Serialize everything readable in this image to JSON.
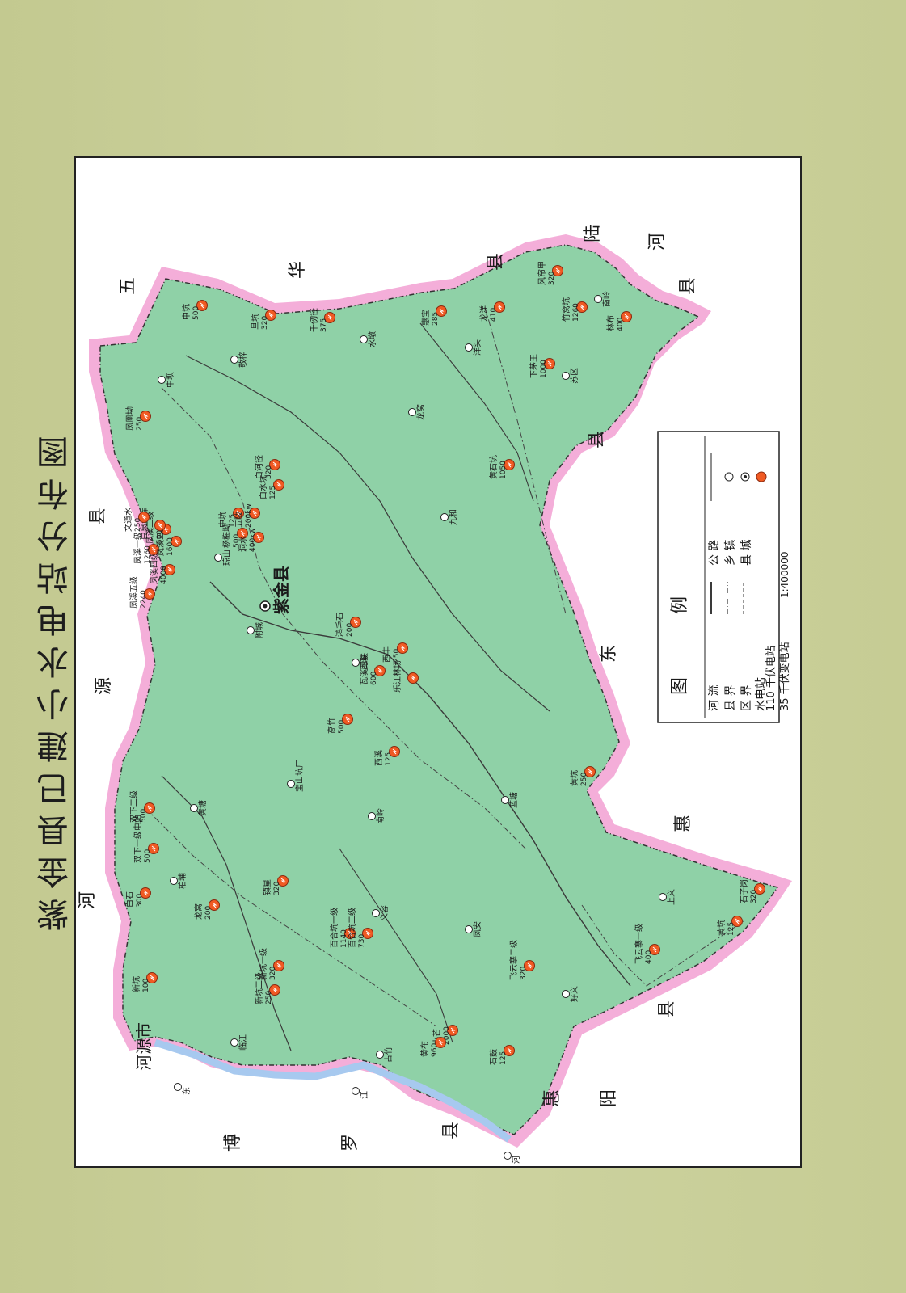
{
  "title": "紫金县已建小水电站分布图",
  "county_seat": "紫金县",
  "neighbors": [
    {
      "text": "河"
    },
    {
      "text": "源"
    },
    {
      "text": "县"
    },
    {
      "text": "五"
    },
    {
      "text": "华"
    },
    {
      "text": "县"
    },
    {
      "text": "陆"
    },
    {
      "text": "河"
    },
    {
      "text": "县"
    },
    {
      "text": "东"
    },
    {
      "text": "县"
    },
    {
      "text": "惠"
    },
    {
      "text": "县"
    },
    {
      "text": "阳"
    },
    {
      "text": "惠"
    },
    {
      "text": "县"
    },
    {
      "text": "罗"
    },
    {
      "text": "博"
    },
    {
      "text": "河源市"
    }
  ],
  "stations": [
    {
      "name": "新坑",
      "cap": "100"
    },
    {
      "name": "白石",
      "cap": "300"
    },
    {
      "name": "龙窝",
      "cap": "200"
    },
    {
      "name": "双下一级电站",
      "cap": "500"
    },
    {
      "name": "双下二级",
      "cap": "500"
    },
    {
      "name": "新坑二级",
      "cap": "250"
    },
    {
      "name": "新坑一级",
      "cap": "320"
    },
    {
      "name": "镇星",
      "cap": "320"
    },
    {
      "name": "百合坑一级",
      "cap": "1140"
    },
    {
      "name": "百合坑二级",
      "cap": "730"
    },
    {
      "name": "西溪",
      "cap": "125"
    },
    {
      "name": "高竹",
      "cap": "500"
    },
    {
      "name": "瓦溪四联",
      "cap": "600"
    },
    {
      "name": "鸿毛石",
      "cap": "200"
    },
    {
      "name": "凤溪四级",
      "cap": "4000"
    },
    {
      "name": "凤溪五级",
      "cap": "2240"
    },
    {
      "name": "凤溪一级",
      "cap": "1260"
    },
    {
      "name": "凤溪二级",
      "cap": "500"
    },
    {
      "name": "凤溪三级",
      "cap": "1600"
    },
    {
      "name": "白泉水库",
      "cap": ""
    },
    {
      "name": "文道水",
      "cap": "250"
    },
    {
      "name": "凤凰坳",
      "cap": "250"
    },
    {
      "name": "中坑",
      "cap": "125"
    },
    {
      "name": "白水坑",
      "cap": "125"
    },
    {
      "name": "白河径",
      "cap": "320"
    },
    {
      "name": "杨梅坳",
      "cap": "500"
    },
    {
      "name": "洞水",
      "cap": "400kw"
    },
    {
      "name": "五陂",
      "cap": "200kw"
    },
    {
      "name": "中坑",
      "cap": "500"
    },
    {
      "name": "旦坑",
      "cap": "320"
    },
    {
      "name": "千仞径",
      "cap": "375"
    },
    {
      "name": "惠宝",
      "cap": "285"
    },
    {
      "name": "龙洋",
      "cap": "410"
    },
    {
      "name": "下茅王",
      "cap": "1000"
    },
    {
      "name": "风帘甲",
      "cap": "320"
    },
    {
      "name": "竹窝坑",
      "cap": "1260"
    },
    {
      "name": "林布",
      "cap": "400"
    },
    {
      "name": "黄石坑",
      "cap": "1050"
    },
    {
      "name": "黄坑",
      "cap": "250"
    },
    {
      "name": "石子岗",
      "cap": "320"
    },
    {
      "name": "黄坑",
      "cap": "125"
    },
    {
      "name": "飞云寨一级",
      "cap": "400"
    },
    {
      "name": "飞云寨二级",
      "cap": "320"
    },
    {
      "name": "石鼓",
      "cap": "125"
    },
    {
      "name": "小芒",
      "cap": "2000"
    },
    {
      "name": "黄布",
      "cap": "960"
    },
    {
      "name": "西丰",
      "cap": "250"
    },
    {
      "name": "乐江林场",
      "cap": ""
    }
  ],
  "places": [
    {
      "text": "中坝"
    },
    {
      "text": "敬梓"
    },
    {
      "text": "水墩"
    },
    {
      "text": "龙窝"
    },
    {
      "text": "苏区"
    },
    {
      "text": "洋头"
    },
    {
      "text": "南岭"
    },
    {
      "text": "九和"
    },
    {
      "text": "瓦溪"
    },
    {
      "text": "附城"
    },
    {
      "text": "琼山"
    },
    {
      "text": "宝山坑厂"
    },
    {
      "text": "黄塘"
    },
    {
      "text": "柏埔"
    },
    {
      "text": "南岭"
    },
    {
      "text": "义容"
    },
    {
      "text": "凤安"
    },
    {
      "text": "上义"
    },
    {
      "text": "好义"
    },
    {
      "text": "古竹"
    },
    {
      "text": "临江"
    },
    {
      "text": "蓝塘"
    },
    {
      "text": "东"
    },
    {
      "text": "江"
    },
    {
      "text": "河"
    }
  ],
  "legend": {
    "heading_1": "图",
    "heading_2": "例",
    "row1_a": "河 流",
    "row1_b": "公 路",
    "row2_a": "县 界",
    "row2_b": "乡 镇",
    "row3_a": "区 界",
    "row3_b": "县 城",
    "row4_a": "水电站",
    "row5_a": "110 千伏电站",
    "row6_a": "35 千伏变电站",
    "scale": "1:400000"
  },
  "colors": {
    "land": "#8fd1a7",
    "border": "#f2a5d6",
    "river": "#a7c9ef",
    "station": "#f05a23",
    "background": "#c9cf9a"
  }
}
